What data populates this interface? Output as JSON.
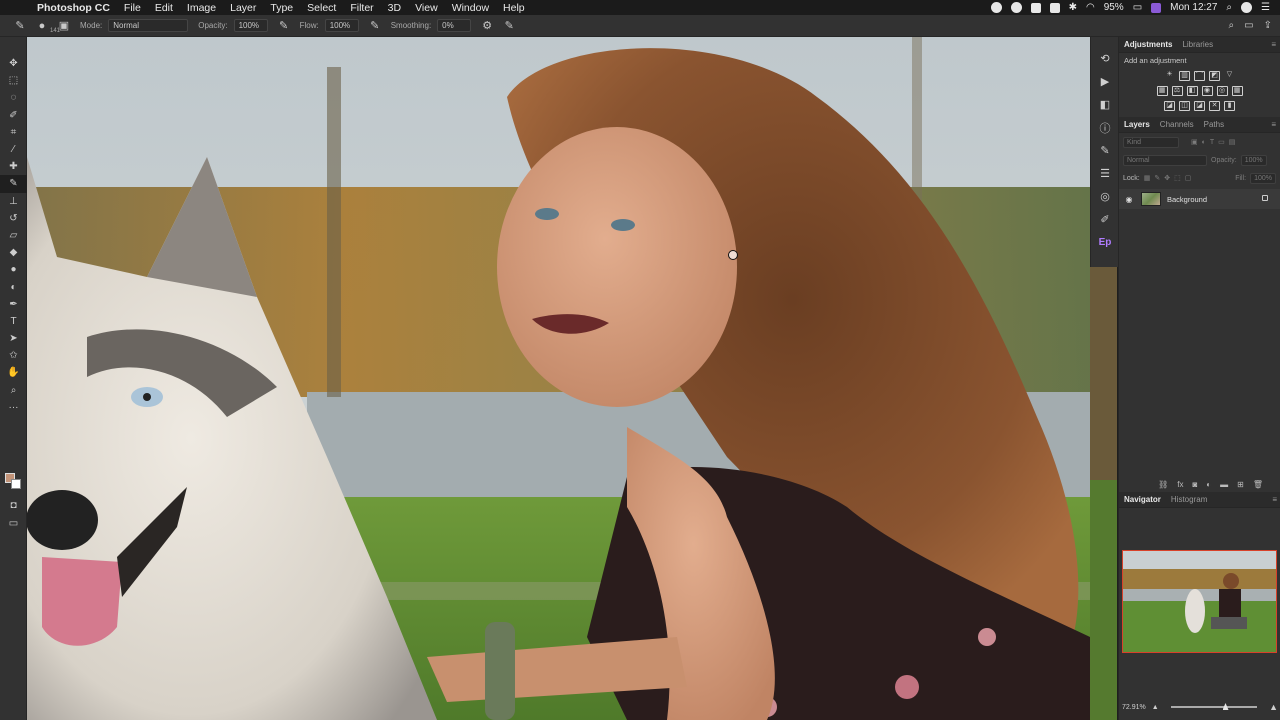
{
  "menubar": {
    "app_name": "Photoshop CC",
    "items": [
      "File",
      "Edit",
      "Image",
      "Layer",
      "Type",
      "Select",
      "Filter",
      "3D",
      "View",
      "Window",
      "Help"
    ],
    "battery": "95%",
    "clock": "Mon 12:27"
  },
  "options_bar": {
    "brush_size": "141",
    "mode_label": "Mode:",
    "mode_value": "Normal",
    "opacity_label": "Opacity:",
    "opacity_value": "100%",
    "flow_label": "Flow:",
    "flow_value": "100%",
    "smoothing_label": "Smoothing:",
    "smoothing_value": "0%"
  },
  "colors": {
    "foreground": "#c29378",
    "background": "#ffffff",
    "navigator_frame": "#d8412a",
    "accent_ep": "#b07cff"
  },
  "adjustments_panel": {
    "tabs": [
      "Adjustments",
      "Libraries"
    ],
    "heading": "Add an adjustment"
  },
  "layers_panel": {
    "tabs": [
      "Layers",
      "Channels",
      "Paths"
    ],
    "kind_placeholder": "Kind",
    "blend_mode": "Normal",
    "opacity_label": "Opacity:",
    "opacity_value": "100%",
    "lock_label": "Lock:",
    "fill_label": "Fill:",
    "fill_value": "100%",
    "layers": [
      {
        "name": "Background",
        "visible": true,
        "locked": true
      }
    ]
  },
  "navigator_panel": {
    "tabs": [
      "Navigator",
      "Histogram"
    ],
    "zoom": "72.91%"
  }
}
